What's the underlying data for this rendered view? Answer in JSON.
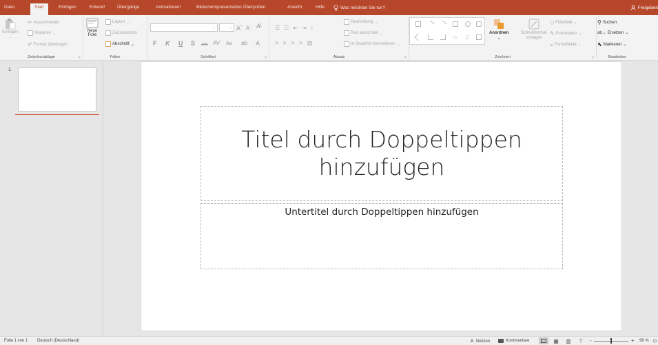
{
  "tabs": [
    {
      "label": "Datei",
      "active": false
    },
    {
      "label": "Start",
      "active": true
    },
    {
      "label": "Einfügen",
      "active": false
    },
    {
      "label": "Entwurf",
      "active": false
    },
    {
      "label": "Übergänge",
      "active": false
    },
    {
      "label": "Animationen",
      "active": false
    },
    {
      "label": "Bildschirmpräsentation",
      "active": false
    },
    {
      "label": "Überprüfen",
      "active": false
    },
    {
      "label": "Ansicht",
      "active": false
    },
    {
      "label": "Hilfe",
      "active": false
    }
  ],
  "tell_me": "Was möchten Sie tun?",
  "share": "Freigeben",
  "ribbon": {
    "clipboard": {
      "paste": "Einfügen",
      "cut": "Ausschneiden",
      "copy": "Kopieren",
      "format_painter": "Format übertragen",
      "label": "Zwischenablage"
    },
    "slides": {
      "new_slide_1": "Neue",
      "new_slide_2": "Folie",
      "layout": "Layout",
      "reset": "Zurücksetzen",
      "section": "Abschnitt",
      "label": "Folien"
    },
    "font": {
      "bold": "F",
      "italic": "K",
      "underline": "U",
      "strike": "S",
      "label": "Schriftart"
    },
    "paragraph": {
      "text_direction": "Textrichtung",
      "align_text": "Text ausrichten",
      "smartart": "In SmartArt konvertieren",
      "label": "Absatz"
    },
    "drawing": {
      "arrange": "Anordnen",
      "quick_styles_1": "Schnellformat-",
      "quick_styles_2": "vorlagen",
      "fill": "Fülleffekt",
      "outline": "Formkontur",
      "effects": "Formeffekte",
      "label": "Zeichnen"
    },
    "editing": {
      "find": "Suchen",
      "replace": "Ersetzen",
      "select": "Markieren",
      "label": "Bearbeiten"
    }
  },
  "thumbnail": {
    "number": "1"
  },
  "slide": {
    "title": "Titel durch Doppeltippen hinzufügen",
    "subtitle": "Untertitel durch Doppeltippen hinzufügen"
  },
  "status": {
    "slide_info": "Folie 1 von 1",
    "language": "Deutsch (Deutschland)",
    "notes": "Notizen",
    "comments": "Kommentare",
    "zoom": "96 %",
    "zoom_minus": "-",
    "zoom_plus": "+"
  },
  "colors": {
    "accent": "#b7472a",
    "insertion_line": "#d24726"
  }
}
